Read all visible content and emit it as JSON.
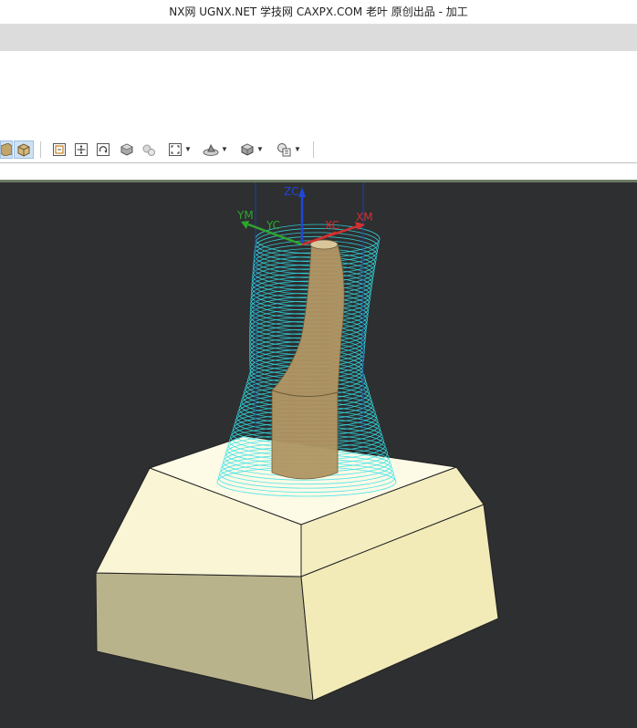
{
  "window": {
    "title": "NX网 UGNX.NET 学技网 CAXPX.COM 老叶 原创出品 - 加工"
  },
  "toolbar": {
    "buttons": [
      {
        "id": "shaded-view",
        "icon": "shaded-cube-icon",
        "active": true
      },
      {
        "id": "shaded-edges-view",
        "icon": "shaded-edges-cube-icon",
        "active": true
      },
      {
        "id": "fit",
        "icon": "fit-view-icon"
      },
      {
        "id": "pan",
        "icon": "pan-icon"
      },
      {
        "id": "rotate",
        "icon": "rotate-icon"
      },
      {
        "id": "render-style",
        "icon": "solid-box-icon"
      },
      {
        "id": "hidden-style",
        "icon": "gears-icon"
      },
      {
        "id": "zoom-region",
        "icon": "zoom-region-icon",
        "dropdown": true
      },
      {
        "id": "orient-view",
        "icon": "orient-view-icon",
        "dropdown": true
      },
      {
        "id": "display-mode",
        "icon": "display-mode-icon",
        "dropdown": true
      },
      {
        "id": "visibility",
        "icon": "visibility-icon",
        "dropdown": true
      }
    ]
  },
  "viewport": {
    "background": "#2d2f31",
    "axes": {
      "zc": "ZC",
      "ym": "YM",
      "yc": "YC",
      "xc": "XC",
      "xm": "XM"
    },
    "colors": {
      "toolpath": "#31e0e8",
      "stock_top": "#fbf7dc",
      "stock_side_right": "#f2ebb8",
      "stock_side_left": "#b9b38c",
      "part": "#b29563",
      "zc": "#2146d6",
      "xc": "#d23030",
      "yc": "#2ea62e"
    }
  }
}
